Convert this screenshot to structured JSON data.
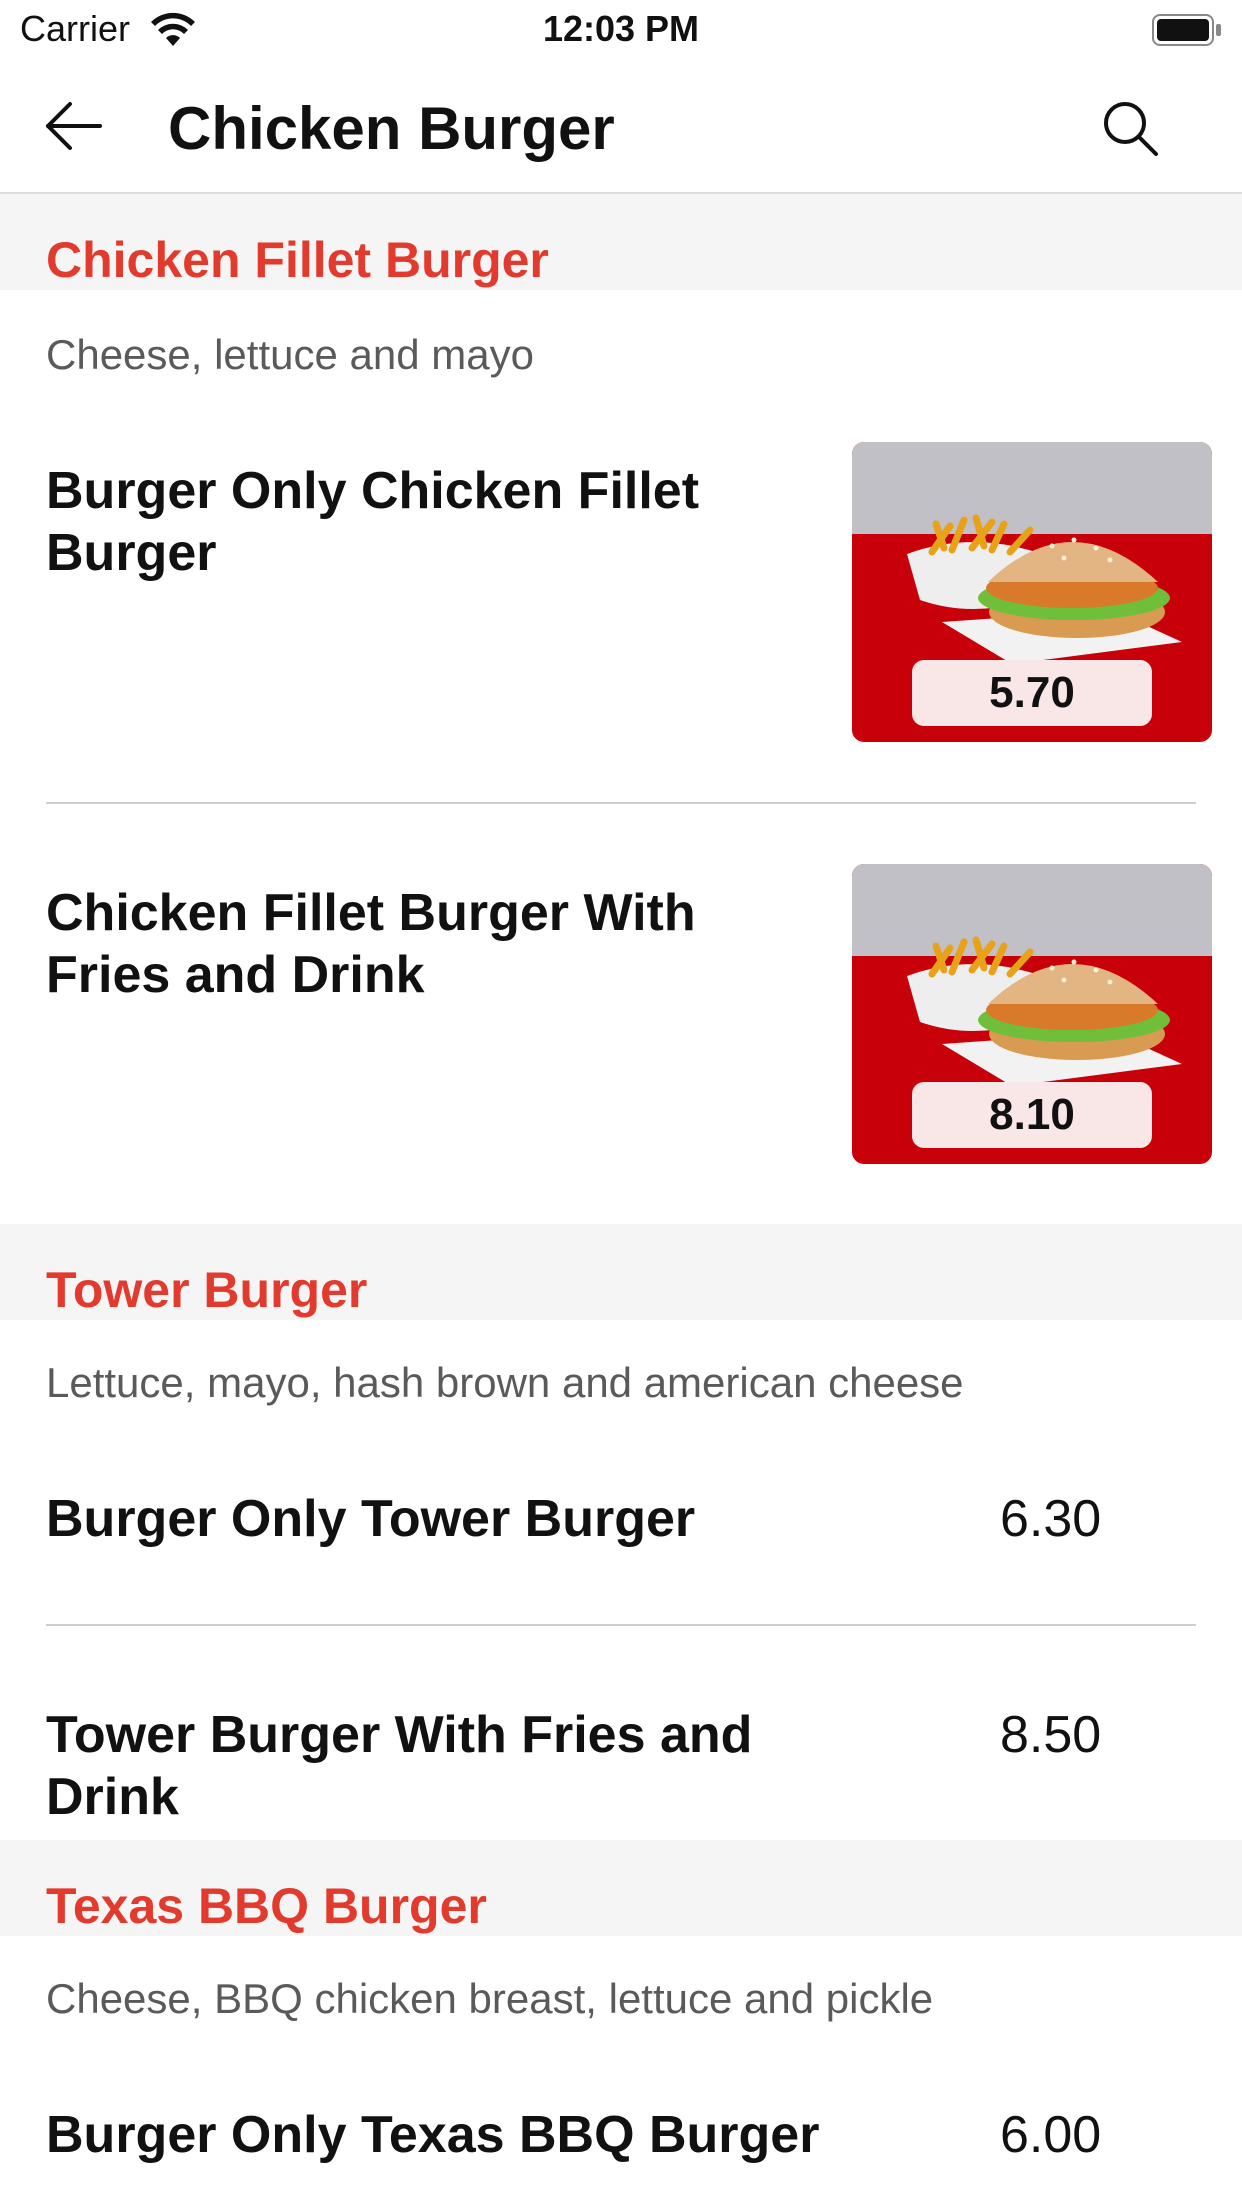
{
  "status_bar": {
    "carrier": "Carrier",
    "time": "12:03 PM"
  },
  "nav": {
    "title": "Chicken Burger",
    "back_icon": "arrow-left-icon",
    "search_icon": "search-icon"
  },
  "sections": [
    {
      "title": "Chicken Fillet Burger",
      "description": "Cheese, lettuce and mayo",
      "items": [
        {
          "name": "Burger Only Chicken Fillet Burger",
          "price": "5.70",
          "image": "burger-with-fries-photo"
        },
        {
          "name": "Chicken Fillet Burger With Fries and Drink",
          "price": "8.10",
          "image": "burger-with-fries-photo"
        }
      ]
    },
    {
      "title": "Tower Burger",
      "description": "Lettuce, mayo, hash brown and american cheese",
      "items": [
        {
          "name": "Burger Only Tower Burger",
          "price": "6.30"
        },
        {
          "name": "Tower Burger With Fries and Drink",
          "price": "8.50"
        }
      ]
    },
    {
      "title": "Texas BBQ Burger",
      "description": "Cheese, BBQ chicken breast, lettuce and pickle",
      "items": [
        {
          "name": "Burger Only Texas BBQ Burger",
          "price": "6.00"
        }
      ]
    }
  ],
  "colors": {
    "accent": "#e23b2e",
    "section_bg": "#f5f5f5",
    "thumb_red": "#c8000a"
  }
}
